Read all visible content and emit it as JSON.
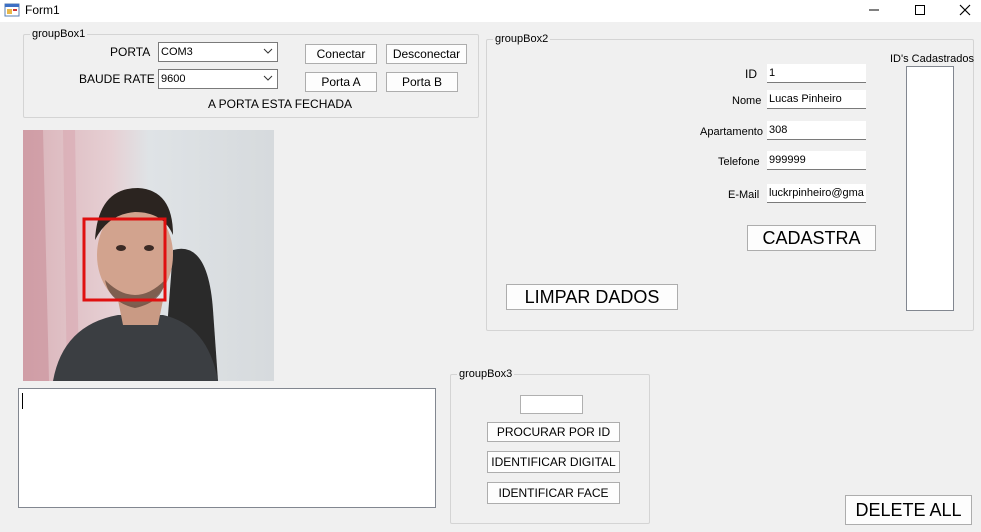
{
  "window": {
    "title": "Form1",
    "minimize_glyph": "—",
    "maximize_glyph": "☐",
    "close_glyph": "✕"
  },
  "groupbox1": {
    "title": "groupBox1",
    "porta_label": "PORTA",
    "porta_value": "COM3",
    "baud_label": "BAUDE RATE",
    "baud_value": "9600",
    "conectar": "Conectar",
    "desconectar": "Desconectar",
    "porta_a": "Porta A",
    "porta_b": "Porta B",
    "status": "A PORTA ESTA FECHADA"
  },
  "groupbox2": {
    "title": "groupBox2",
    "id_label": "ID",
    "id_value": "1",
    "nome_label": "Nome",
    "nome_value": "Lucas Pinheiro",
    "apto_label": "Apartamento",
    "apto_value": "308",
    "tel_label": "Telefone",
    "tel_value": "999999",
    "email_label": "E-Mail",
    "email_value": "luckrpinheiro@gmail",
    "cadastra": "CADASTRA",
    "limpar": "LIMPAR DADOS",
    "ids_label": "ID's Cadastrados"
  },
  "groupbox3": {
    "title": "groupBox3",
    "search_value": "",
    "procurar": "PROCURAR POR ID",
    "digital": "IDENTIFICAR DIGITAL",
    "face": "IDENTIFICAR FACE"
  },
  "delete_all": "DELETE ALL",
  "colors": {
    "face_box": "#e01010",
    "window_bg": "#f0f0f0"
  },
  "icons": {
    "app": "form-app-icon",
    "dropdown": "chevron-down-icon"
  }
}
